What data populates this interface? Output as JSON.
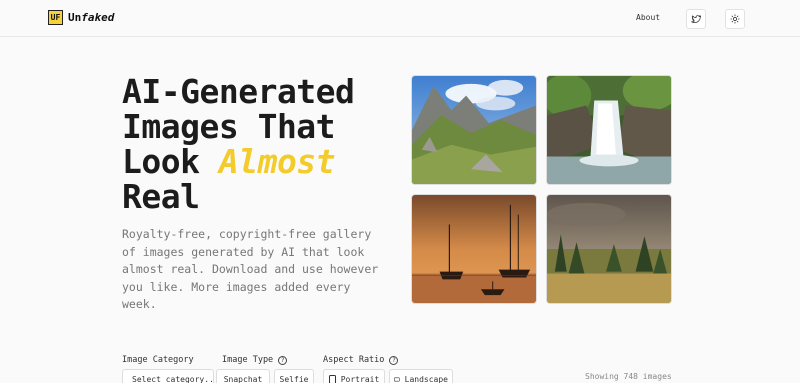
{
  "header": {
    "logo_badge": "UF",
    "logo_name_plain": "Un",
    "logo_name_italic": "faked",
    "about_label": "About",
    "twitter_icon": "twitter-icon",
    "theme_icon": "sun-icon"
  },
  "hero": {
    "title_line1": "AI-Generated",
    "title_line2": "Images That",
    "title_line3_plain": "Look ",
    "title_line3_accent": "Almost",
    "title_line4": "Real",
    "description": "Royalty-free, copyright-free gallery of images generated by AI that look almost real. Download and use however you like. More images added every week."
  },
  "gallery": {
    "tiles": [
      "mountain-valley",
      "waterfall",
      "harbor-sunset",
      "forest-meadow"
    ]
  },
  "filters": {
    "category_label": "Image Category",
    "category_value": "Select category...",
    "type_label": "Image Type",
    "type_options": [
      "Snapchat",
      "Selfie"
    ],
    "aspect_label": "Aspect Ratio",
    "aspect_options": [
      "Portrait",
      "Landscape"
    ],
    "help_glyph": "?",
    "showing_text": "Showing 748 images"
  },
  "colors": {
    "accent": "#f3cc2c",
    "text": "#1c1c1c",
    "muted": "#777777"
  }
}
